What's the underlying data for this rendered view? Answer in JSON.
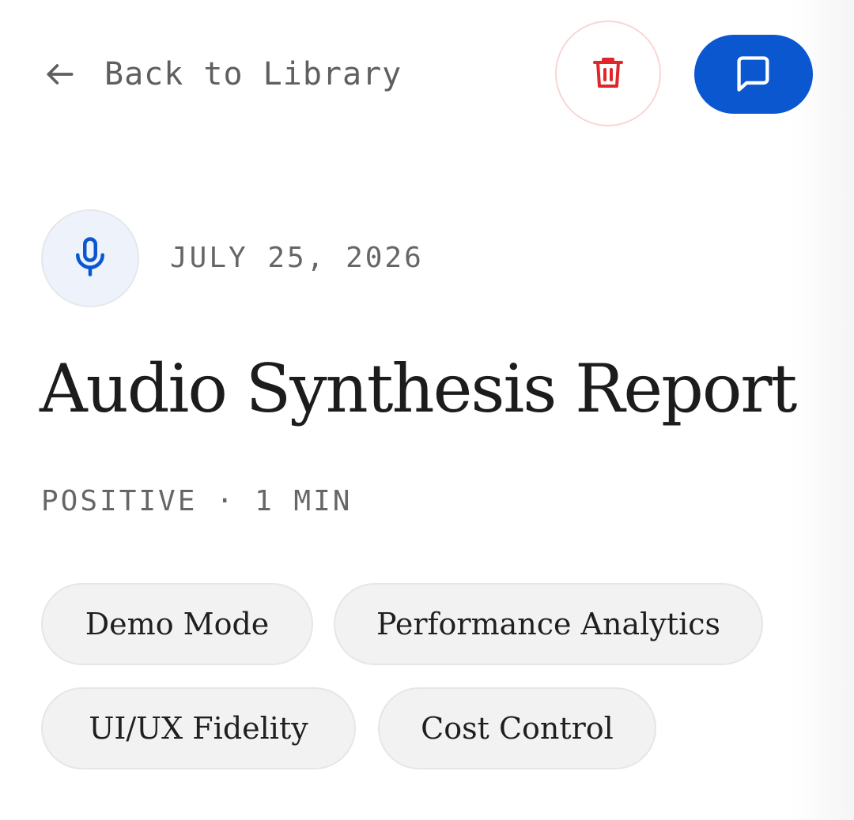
{
  "header": {
    "back_label": "Back to Library",
    "back_icon": "arrow-left-icon",
    "delete_icon": "trash-icon",
    "chat_icon": "message-square-icon"
  },
  "meta": {
    "source_icon": "microphone-icon",
    "date": "JULY 25, 2026"
  },
  "title": "Audio Synthesis Report",
  "summary": {
    "sentiment": "POSITIVE",
    "separator": "·",
    "duration": "1 MIN"
  },
  "tags": [
    "Demo Mode",
    "Performance Analytics",
    "UI/UX Fidelity",
    "Cost Control"
  ],
  "colors": {
    "accent": "#0a57d0",
    "danger": "#e0262b",
    "danger_border": "#f9d6d6",
    "tag_background": "#f2f2f2",
    "muted_text": "#666666",
    "title_text": "#1c1c1c"
  }
}
